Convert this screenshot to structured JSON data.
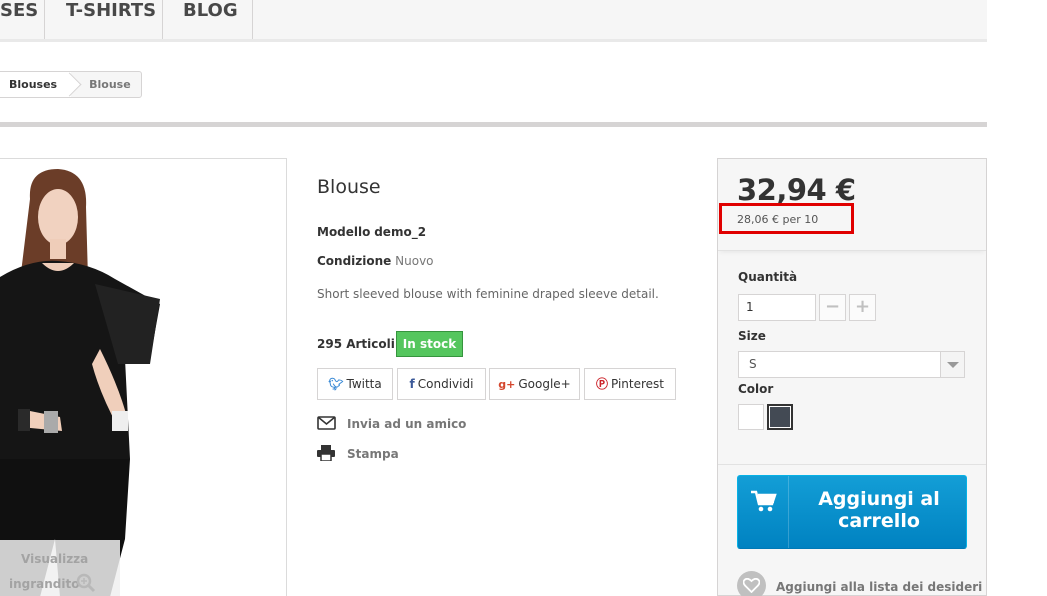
{
  "nav": {
    "items": [
      "SES",
      "T-SHIRTS",
      "BLOG"
    ]
  },
  "breadcrumb": [
    "Blouses",
    "Blouse"
  ],
  "image": {
    "zoom_line1": "Visualizza",
    "zoom_line2": "ingrandito"
  },
  "product": {
    "name": "Blouse",
    "reference_label": "Modello",
    "reference_value": "demo_2",
    "condition_label": "Condizione",
    "condition_value": "Nuovo",
    "description": "Short sleeved blouse with feminine draped sleeve detail.",
    "quantity_text": "295 Articoli",
    "availability": "In stock"
  },
  "share": {
    "twitter": "Twitta",
    "facebook": "Condividi",
    "googleplus": "Google+",
    "pinterest": "Pinterest"
  },
  "links": {
    "send_friend": "Invia ad un amico",
    "print": "Stampa"
  },
  "buybox": {
    "price": "32,94 €",
    "unit_price": "28,06 € per 10",
    "quantity_label": "Quantità",
    "quantity_value": "1",
    "size_label": "Size",
    "size_value": "S",
    "color_label": "Color",
    "colors": [
      "#ffffff",
      "#434a54"
    ],
    "add_to_cart": "Aggiungi al carrello",
    "wishlist": "Aggiungi alla lista dei desideri",
    "highlight_color": "#e00000",
    "button_color": "#0f96d0"
  }
}
